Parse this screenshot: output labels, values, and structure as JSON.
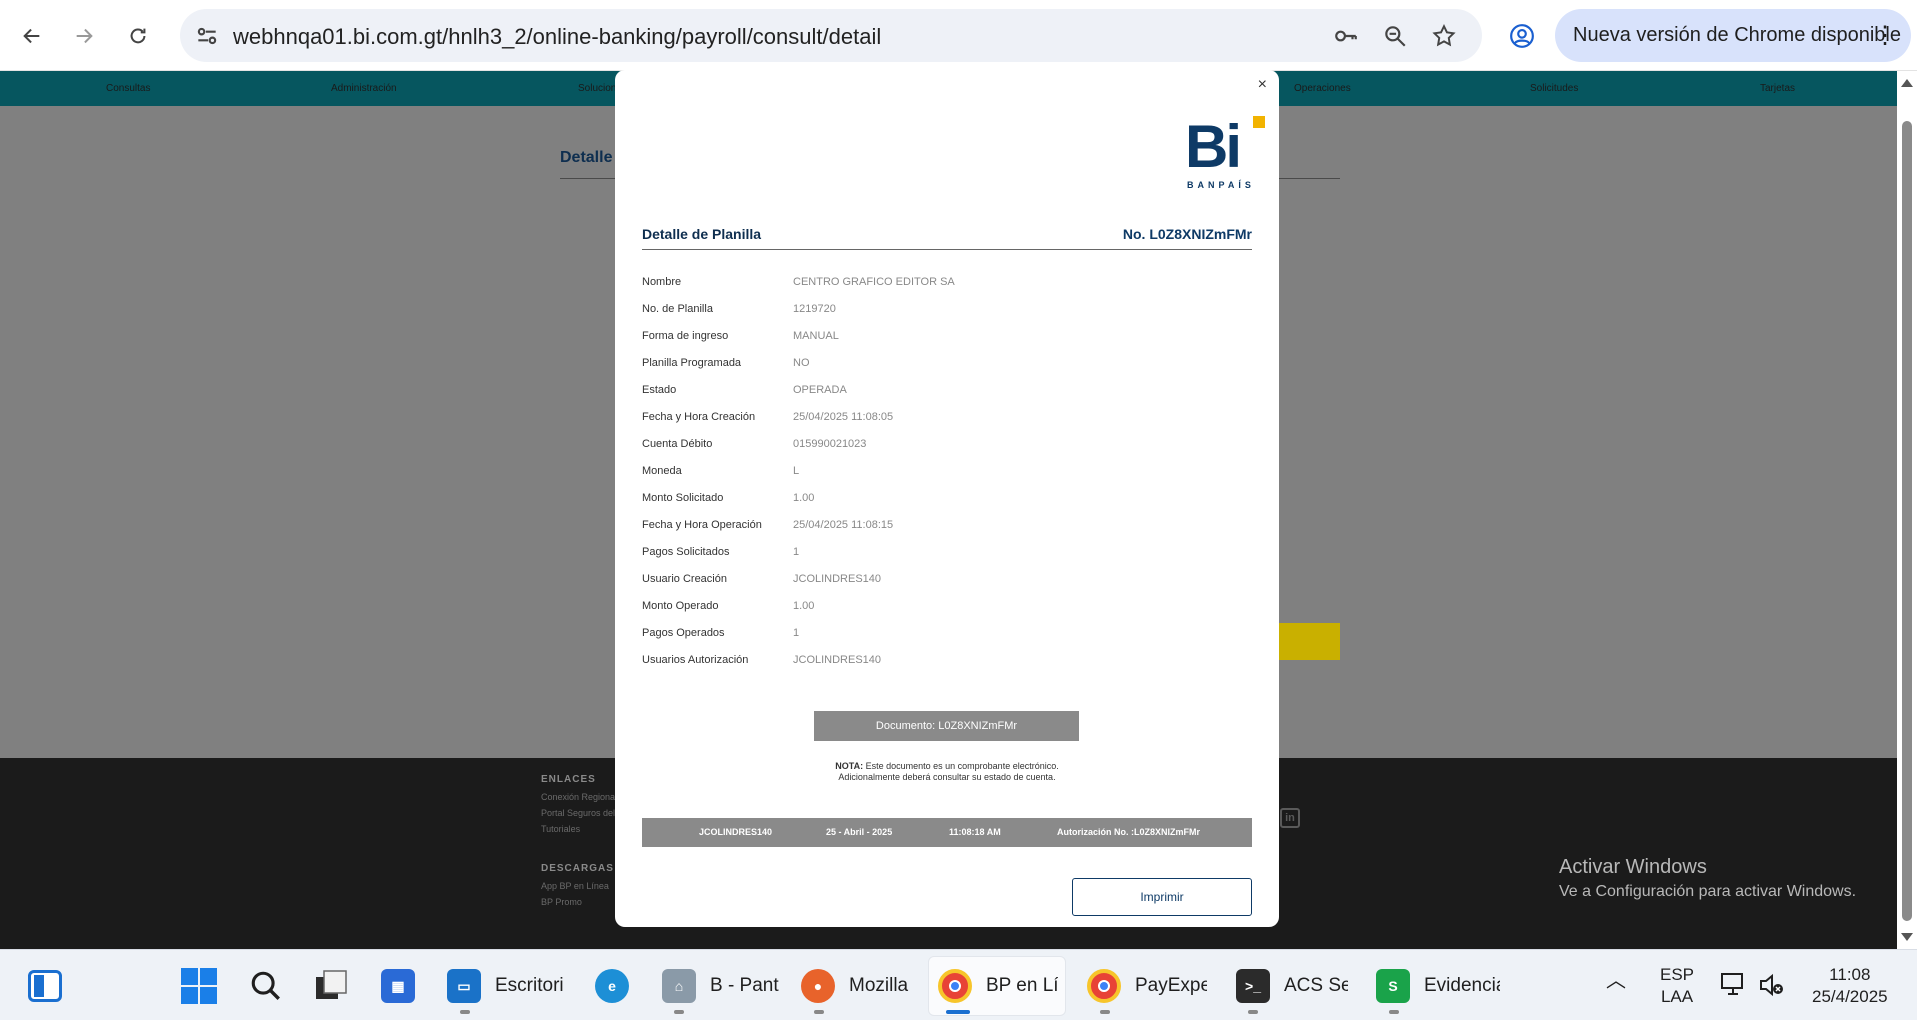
{
  "browser": {
    "url": "webhnqa01.bi.com.gt/hnlh3_2/online-banking/payroll/consult/detail",
    "update_label": "Nueva versión de Chrome disponible"
  },
  "nav": {
    "items": [
      "Consultas",
      "Administración",
      "Soluciones",
      "Operaciones",
      "Solicitudes",
      "Tarjetas"
    ]
  },
  "page_background": {
    "title_fragment": "Detalle d"
  },
  "footer": {
    "enlaces_heading": "ENLACES",
    "enlaces": [
      "Conexión Regional",
      "Portal Seguros del",
      "Tutoriales"
    ],
    "descargas_heading": "DESCARGAS",
    "descargas": [
      "App BP en Línea",
      "BP Promo"
    ]
  },
  "windows_activation": {
    "title": "Activar Windows",
    "subtitle": "Ve a Configuración para activar Windows."
  },
  "modal": {
    "logo_text": "Bi",
    "logo_subtext": "BANPAÍS",
    "title": "Detalle de Planilla",
    "number": "No. L0Z8XNIZmFMr",
    "fields": [
      {
        "label": "Nombre",
        "value": "CENTRO GRAFICO EDITOR SA"
      },
      {
        "label": "No. de Planilla",
        "value": "1219720"
      },
      {
        "label": "Forma de ingreso",
        "value": "MANUAL"
      },
      {
        "label": "Planilla Programada",
        "value": "NO"
      },
      {
        "label": "Estado",
        "value": "OPERADA"
      },
      {
        "label": "Fecha y Hora Creación",
        "value": "25/04/2025 11:08:05"
      },
      {
        "label": "Cuenta Débito",
        "value": "015990021023"
      },
      {
        "label": "Moneda",
        "value": "L"
      },
      {
        "label": "Monto Solicitado",
        "value": "1.00"
      },
      {
        "label": "Fecha y Hora Operación",
        "value": "25/04/2025 11:08:15"
      },
      {
        "label": "Pagos Solicitados",
        "value": "1"
      },
      {
        "label": "Usuario Creación",
        "value": "JCOLINDRES140"
      },
      {
        "label": "Monto Operado",
        "value": "1.00"
      },
      {
        "label": "Pagos Operados",
        "value": "1"
      },
      {
        "label": "Usuarios Autorización",
        "value": "JCOLINDRES140"
      }
    ],
    "document_label": "Documento: L0Z8XNIZmFMr",
    "nota_label": "NOTA:",
    "nota_line1": "Este documento es un comprobante electrónico.",
    "nota_line2": "Adicionalmente deberá consultar su estado de cuenta.",
    "info_bar": {
      "user": "JCOLINDRES140",
      "date": "25 - Abril - 2025",
      "time": "11:08:18 AM",
      "auth": "Autorización No. :L0Z8XNIZmFMr"
    },
    "print_label": "Imprimir",
    "close_glyph": "×"
  },
  "taskbar": {
    "apps": [
      {
        "label": "Escritorio"
      },
      {
        "label": "B - Pant"
      },
      {
        "label": "Mozilla"
      },
      {
        "label": "BP en Lír"
      },
      {
        "label": "PayExpec"
      },
      {
        "label": "ACS Ses"
      },
      {
        "label": "Evidencia"
      }
    ],
    "lang_top": "ESP",
    "lang_bottom": "LAA",
    "time": "11:08",
    "date": "25/4/2025"
  }
}
